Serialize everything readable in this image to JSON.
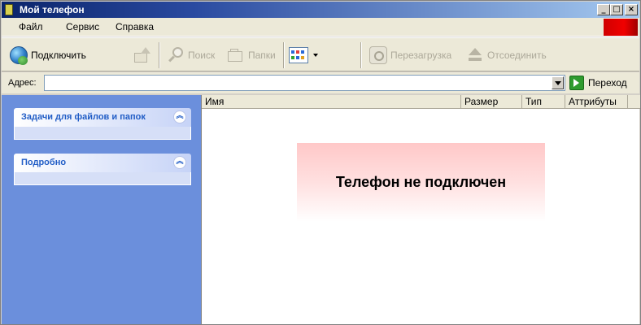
{
  "window": {
    "title": "Мой телефон",
    "controls": {
      "minimize": "_",
      "maximize": "□",
      "close": "×"
    }
  },
  "menu": {
    "items": [
      {
        "label": "Файл"
      },
      {
        "label": "Сервис"
      },
      {
        "label": "Справка"
      }
    ]
  },
  "toolbar": {
    "connect": "Подключить",
    "search": "Поиск",
    "folders": "Папки",
    "reboot": "Перезагрузка",
    "disconnect": "Отсоединить"
  },
  "address": {
    "label": "Адрес:",
    "value": "",
    "go": "Переход"
  },
  "tasks": [
    {
      "title": "Задачи для файлов и папок"
    },
    {
      "title": "Подробно"
    }
  ],
  "columns": [
    {
      "label": "Имя"
    },
    {
      "label": "Размер"
    },
    {
      "label": "Тип"
    },
    {
      "label": "Аттрибуты"
    }
  ],
  "status": {
    "message": "Телефон не подключен"
  },
  "colors": {
    "title_bar_start": "#0a246a",
    "panel_bg": "#6b8fdc",
    "task_title": "#215dc6",
    "brand": "#e00000"
  },
  "icons": [
    "globe-icon",
    "up-folder-icon",
    "search-icon",
    "folders-icon",
    "views-icon",
    "reboot-icon",
    "eject-icon",
    "go-icon",
    "collapse-icon"
  ]
}
